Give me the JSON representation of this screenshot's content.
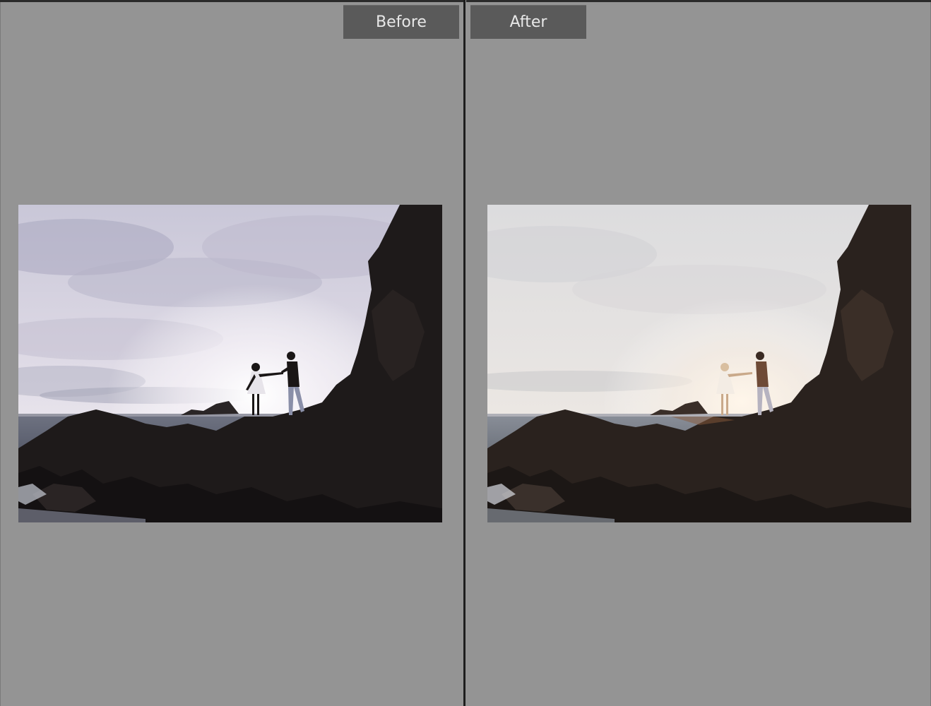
{
  "compare_view": {
    "before_label": "Before",
    "after_label": "After"
  },
  "colors": {
    "background": "#949494",
    "label_bg": "#5a5a5a",
    "label_text": "#e8e8e8",
    "divider": "#1e1e1e"
  },
  "photos": {
    "before": {
      "subject": "couple-on-sea-rocks-sunset",
      "treatment": "cool-underexposed"
    },
    "after": {
      "subject": "couple-on-sea-rocks-sunset",
      "treatment": "warm-brightened"
    }
  }
}
